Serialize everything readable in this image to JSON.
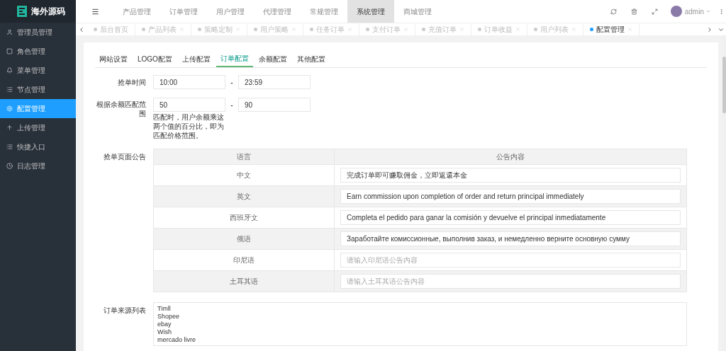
{
  "brand": {
    "title": "海外源码"
  },
  "sidebar": {
    "items": [
      {
        "label": "管理员管理",
        "selected": false
      },
      {
        "label": "角色管理",
        "selected": false
      },
      {
        "label": "菜单管理",
        "selected": false
      },
      {
        "label": "节点管理",
        "selected": false
      },
      {
        "label": "配置管理",
        "selected": true
      },
      {
        "label": "上传管理",
        "selected": false
      },
      {
        "label": "快捷入口",
        "selected": false
      },
      {
        "label": "日志管理",
        "selected": false
      }
    ]
  },
  "top_nav": {
    "items": [
      {
        "label": "产品管理",
        "selected": false
      },
      {
        "label": "订单管理",
        "selected": false
      },
      {
        "label": "用户管理",
        "selected": false
      },
      {
        "label": "代理管理",
        "selected": false
      },
      {
        "label": "常规管理",
        "selected": false
      },
      {
        "label": "系统管理",
        "selected": true
      },
      {
        "label": "商城管理",
        "selected": false
      }
    ],
    "user": "admin"
  },
  "page_tabs": [
    {
      "label": "后台首页",
      "selected": false,
      "closable": false
    },
    {
      "label": "产品列表",
      "selected": false,
      "closable": true
    },
    {
      "label": "策略定制",
      "selected": false,
      "closable": true
    },
    {
      "label": "用户策略",
      "selected": false,
      "closable": true
    },
    {
      "label": "任务订单",
      "selected": false,
      "closable": true
    },
    {
      "label": "支付订单",
      "selected": false,
      "closable": true
    },
    {
      "label": "充值订单",
      "selected": false,
      "closable": true
    },
    {
      "label": "订单收益",
      "selected": false,
      "closable": true
    },
    {
      "label": "用户列表",
      "selected": false,
      "closable": true
    },
    {
      "label": "配置管理",
      "selected": true,
      "closable": true
    }
  ],
  "config_tabs": [
    {
      "label": "网站设置",
      "selected": false
    },
    {
      "label": "LOGO配置",
      "selected": false
    },
    {
      "label": "上传配置",
      "selected": false
    },
    {
      "label": "订单配置",
      "selected": true
    },
    {
      "label": "余额配置",
      "selected": false
    },
    {
      "label": "其他配置",
      "selected": false
    }
  ],
  "form": {
    "grab_time": {
      "label": "抢单时间",
      "from": "10:00",
      "separator": "-",
      "to": "23:59"
    },
    "balance_range": {
      "label": "根据余额匹配范围",
      "from": "50",
      "separator": "-",
      "to": "90",
      "help": "匹配时，用户余额乘这两个值的百分比，即为匹配价格范围。"
    },
    "notice": {
      "label": "抢单页面公告",
      "columns": [
        "语言",
        "公告内容"
      ],
      "rows": [
        {
          "language": "中文",
          "value": "完成订单即可赚取佣金，立即返還本金"
        },
        {
          "language": "英文",
          "value": "Earn commission upon completion of order and return principal immediately"
        },
        {
          "language": "西班牙文",
          "value": "Completa el pedido para ganar la comisión y devuelve el principal inmediatamente"
        },
        {
          "language": "俄语",
          "value": "Заработайте комиссионные, выполнив заказ, и немедленно верните основную сумму"
        },
        {
          "language": "印尼语",
          "placeholder": "请输入印尼语公告内容"
        },
        {
          "language": "土耳其语",
          "placeholder": "请输入土耳其语公告内容"
        }
      ]
    },
    "sources": {
      "label": "订单来源列表",
      "value": "Timll\nShopee\nebay\nWish\nmercado livre"
    }
  }
}
